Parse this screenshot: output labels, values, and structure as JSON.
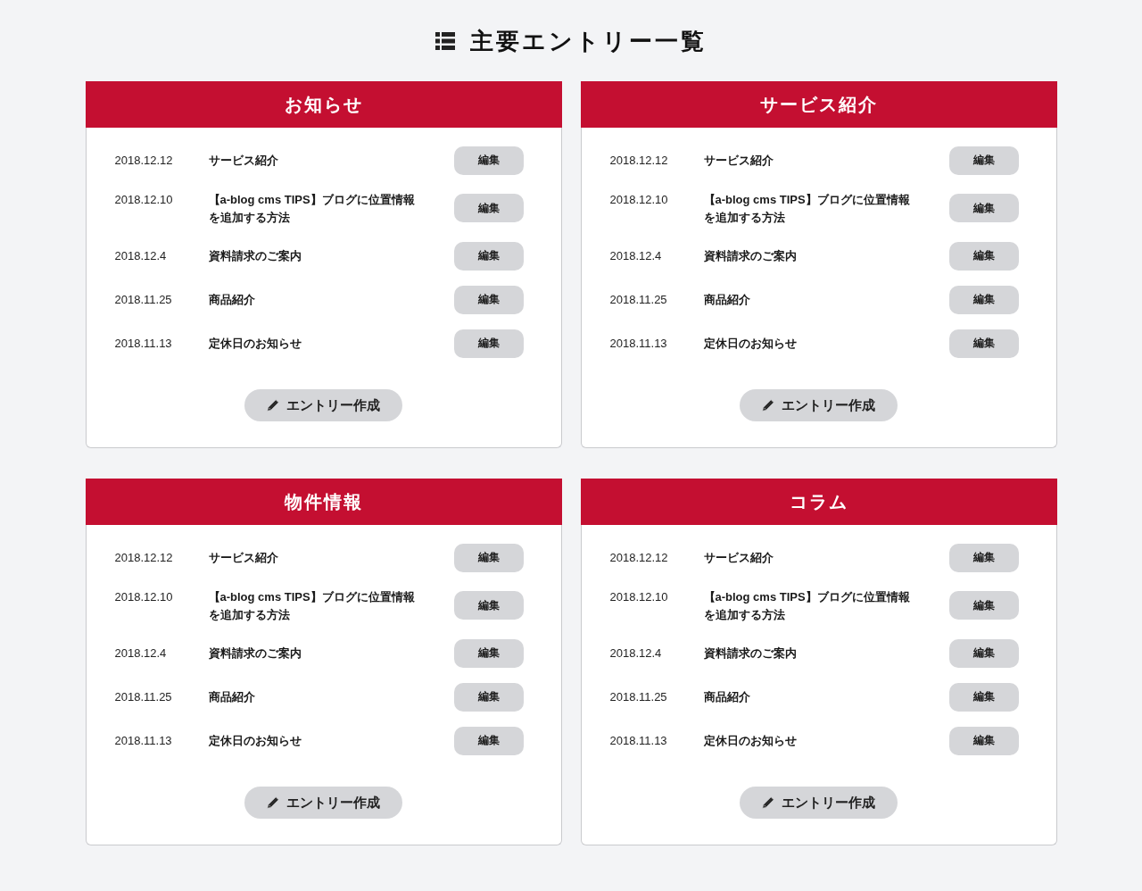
{
  "page": {
    "title": "主要エントリー一覧"
  },
  "panels": [
    {
      "title": "お知らせ",
      "entries": [
        {
          "date": "2018.12.12",
          "title": "サービス紹介",
          "action": "編集"
        },
        {
          "date": "2018.12.10",
          "title": "【a-blog cms TIPS】ブログに位置情報を追加する方法",
          "action": "編集"
        },
        {
          "date": "2018.12.4",
          "title": "資料請求のご案内",
          "action": "編集"
        },
        {
          "date": "2018.11.25",
          "title": "商品紹介",
          "action": "編集"
        },
        {
          "date": "2018.11.13",
          "title": "定休日のお知らせ",
          "action": "編集"
        }
      ],
      "create_button": "エントリー作成"
    },
    {
      "title": "サービス紹介",
      "entries": [
        {
          "date": "2018.12.12",
          "title": "サービス紹介",
          "action": "編集"
        },
        {
          "date": "2018.12.10",
          "title": "【a-blog cms TIPS】ブログに位置情報を追加する方法",
          "action": "編集"
        },
        {
          "date": "2018.12.4",
          "title": "資料請求のご案内",
          "action": "編集"
        },
        {
          "date": "2018.11.25",
          "title": "商品紹介",
          "action": "編集"
        },
        {
          "date": "2018.11.13",
          "title": "定休日のお知らせ",
          "action": "編集"
        }
      ],
      "create_button": "エントリー作成"
    },
    {
      "title": "物件情報",
      "entries": [
        {
          "date": "2018.12.12",
          "title": "サービス紹介",
          "action": "編集"
        },
        {
          "date": "2018.12.10",
          "title": "【a-blog cms TIPS】ブログに位置情報を追加する方法",
          "action": "編集"
        },
        {
          "date": "2018.12.4",
          "title": "資料請求のご案内",
          "action": "編集"
        },
        {
          "date": "2018.11.25",
          "title": "商品紹介",
          "action": "編集"
        },
        {
          "date": "2018.11.13",
          "title": "定休日のお知らせ",
          "action": "編集"
        }
      ],
      "create_button": "エントリー作成"
    },
    {
      "title": "コラム",
      "entries": [
        {
          "date": "2018.12.12",
          "title": "サービス紹介",
          "action": "編集"
        },
        {
          "date": "2018.12.10",
          "title": "【a-blog cms TIPS】ブログに位置情報を追加する方法",
          "action": "編集"
        },
        {
          "date": "2018.12.4",
          "title": "資料請求のご案内",
          "action": "編集"
        },
        {
          "date": "2018.11.25",
          "title": "商品紹介",
          "action": "編集"
        },
        {
          "date": "2018.11.13",
          "title": "定休日のお知らせ",
          "action": "編集"
        }
      ],
      "create_button": "エントリー作成"
    }
  ]
}
